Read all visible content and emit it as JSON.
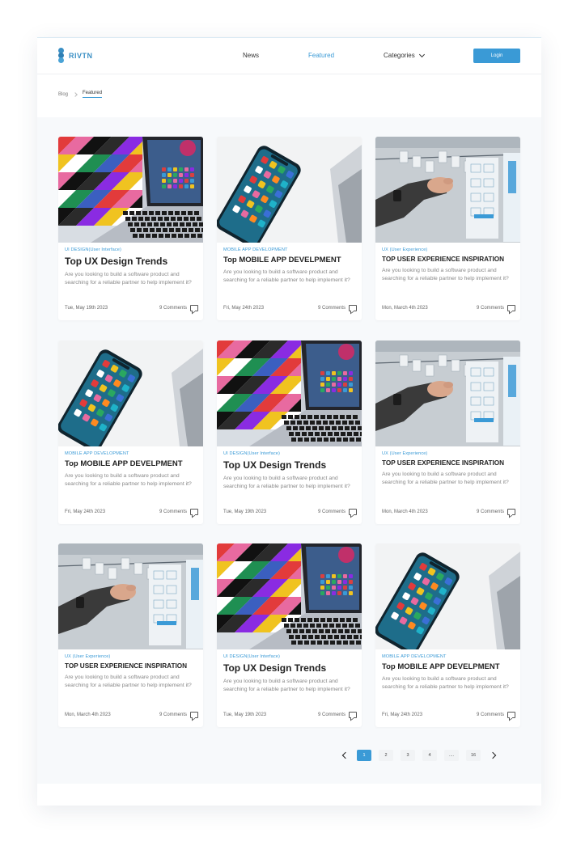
{
  "brand": {
    "name": "RIVTN"
  },
  "nav": {
    "news": "News",
    "featured": "Featured",
    "categories": "Categories",
    "login": "Login"
  },
  "breadcrumb": {
    "root": "Blog",
    "current": "Featured"
  },
  "colors": {
    "accent": "#3a9ad6",
    "background": "#f7f9fb"
  },
  "cards": [
    {
      "image": "laptop-photo",
      "category": "UI DESIGN(User Interface)",
      "title": "Top UX Design Trends",
      "description": "Are you looking to build a software product and searching for a reliable partner to help implement it?",
      "date": "Tue, May 19th 2023",
      "comments": "9 Comments"
    },
    {
      "image": "phone-photo",
      "category": "MOBILE APP DEVELOPMENT",
      "title": "Top MOBILE APP DEVELPMENT",
      "description": "Are you looking to build a software product and searching for a reliable partner to help implement it?",
      "date": "Fri, May 24th 2023",
      "comments": "9 Comments"
    },
    {
      "image": "whiteboard-photo",
      "category": "UX (User Experience)",
      "title": "TOP USER EXPERIENCE INSPIRATION",
      "description": "Are you looking to build a software product and searching for a reliable partner to help implement it?",
      "date": "Mon, March 4th 2023",
      "comments": "9 Comments"
    },
    {
      "image": "phone-photo",
      "category": "MOBILE APP DEVELOPMENT",
      "title": "Top MOBILE APP DEVELPMENT",
      "description": "Are you looking to build a software product and searching for a reliable partner to help implement it?",
      "date": "Fri, May 24th 2023",
      "comments": "9 Comments"
    },
    {
      "image": "laptop-photo",
      "category": "UI DESIGN(User Interface)",
      "title": "Top UX Design Trends",
      "description": "Are you looking to build a software product and searching for a reliable partner to help implement it?",
      "date": "Tue, May 19th 2023",
      "comments": "9 Comments"
    },
    {
      "image": "whiteboard-photo",
      "category": "UX (User Experience)",
      "title": "TOP USER EXPERIENCE INSPIRATION",
      "description": "Are you looking to build a software product and searching for a reliable partner to help implement it?",
      "date": "Mon, March 4th 2023",
      "comments": "9 Comments"
    },
    {
      "image": "whiteboard-photo",
      "category": "UX (User Experience)",
      "title": "TOP USER EXPERIENCE INSPIRATION",
      "description": "Are you looking to build a software product and searching for a reliable partner to help implement it?",
      "date": "Mon, March 4th 2023",
      "comments": "9 Comments"
    },
    {
      "image": "laptop-photo",
      "category": "UI DESIGN(User Interface)",
      "title": "Top UX Design Trends",
      "description": "Are you looking to build a software product and searching for a reliable partner to help implement it?",
      "date": "Tue, May 19th 2023",
      "comments": "9 Comments"
    },
    {
      "image": "phone-photo",
      "category": "MOBILE APP DEVELOPMENT",
      "title": "Top MOBILE APP DEVELPMENT",
      "description": "Are you looking to build a software product and searching for a reliable partner to help implement it?",
      "date": "Fri, May 24th 2023",
      "comments": "9 Comments"
    }
  ],
  "pagination": {
    "pages": [
      "1",
      "2",
      "3",
      "4",
      "....",
      "16"
    ],
    "current": "1"
  }
}
